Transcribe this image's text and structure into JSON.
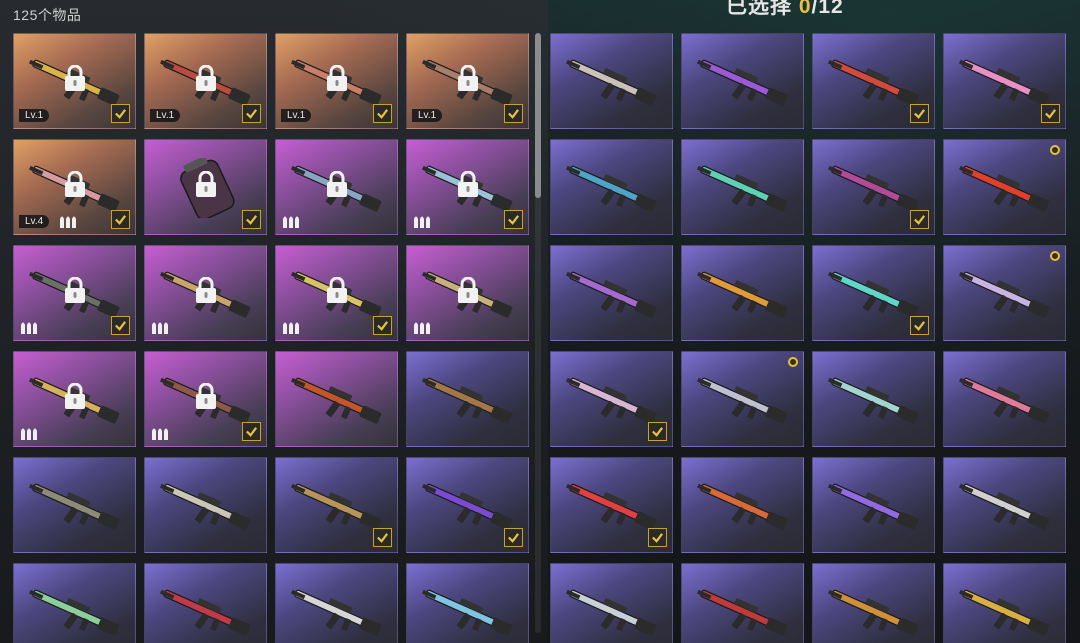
{
  "header": {
    "count_label": "125个物品",
    "selected_prefix": "已选择 ",
    "selected_count": "0",
    "selected_total": "/12"
  },
  "colors": {
    "accent": "#e9c23a",
    "check_border": "#c9a227"
  },
  "left_items": [
    {
      "bg": "gold",
      "weapon_color": "#d9b34a",
      "locked": true,
      "level": "Lv.1",
      "checked": true,
      "ammo": false
    },
    {
      "bg": "gold",
      "weapon_color": "#b94b3f",
      "locked": true,
      "level": "Lv.1",
      "checked": true,
      "ammo": false
    },
    {
      "bg": "gold",
      "weapon_color": "#c97f66",
      "locked": true,
      "level": "Lv.1",
      "checked": true,
      "ammo": false
    },
    {
      "bg": "gold",
      "weapon_color": "#a77e6a",
      "locked": true,
      "level": "Lv.1",
      "checked": true,
      "ammo": false
    },
    {
      "bg": "gold",
      "weapon_color": "#d79aa1",
      "locked": true,
      "level": "Lv.4",
      "checked": true,
      "ammo": true
    },
    {
      "bg": "magenta",
      "weapon_color": "#4a3547",
      "locked": true,
      "level": "",
      "checked": true,
      "ammo": false,
      "shape": "grenade"
    },
    {
      "bg": "magenta",
      "weapon_color": "#8aa4c6",
      "locked": true,
      "level": "",
      "checked": false,
      "ammo": true
    },
    {
      "bg": "magenta",
      "weapon_color": "#9bc1d8",
      "locked": true,
      "level": "",
      "checked": true,
      "ammo": true
    },
    {
      "bg": "magenta",
      "weapon_color": "#6b6f66",
      "locked": true,
      "level": "",
      "checked": true,
      "ammo": true
    },
    {
      "bg": "magenta",
      "weapon_color": "#c8a66b",
      "locked": true,
      "level": "",
      "checked": false,
      "ammo": true
    },
    {
      "bg": "magenta",
      "weapon_color": "#d9c264",
      "locked": true,
      "level": "",
      "checked": true,
      "ammo": true
    },
    {
      "bg": "magenta",
      "weapon_color": "#c9b07a",
      "locked": true,
      "level": "",
      "checked": false,
      "ammo": true
    },
    {
      "bg": "magenta",
      "weapon_color": "#d6b15c",
      "locked": true,
      "level": "",
      "checked": false,
      "ammo": true
    },
    {
      "bg": "magenta",
      "weapon_color": "#8c5a4a",
      "locked": true,
      "level": "",
      "checked": true,
      "ammo": true
    },
    {
      "bg": "magenta",
      "weapon_color": "#c2552b",
      "locked": false,
      "level": "",
      "checked": false,
      "ammo": false
    },
    {
      "bg": "purple",
      "weapon_color": "#a3774a",
      "locked": false,
      "level": "",
      "checked": false,
      "ammo": false
    },
    {
      "bg": "purple",
      "weapon_color": "#8e8a78",
      "locked": false,
      "level": "",
      "checked": false,
      "ammo": false
    },
    {
      "bg": "purple",
      "weapon_color": "#c9c6b6",
      "locked": false,
      "level": "",
      "checked": false,
      "ammo": false
    },
    {
      "bg": "purple",
      "weapon_color": "#b8935a",
      "locked": false,
      "level": "",
      "checked": true,
      "ammo": false
    },
    {
      "bg": "purple",
      "weapon_color": "#7a4ad1",
      "locked": false,
      "level": "",
      "checked": true,
      "ammo": false
    },
    {
      "bg": "purple",
      "weapon_color": "#8dcf9a",
      "locked": false,
      "level": "",
      "checked": false,
      "ammo": false
    },
    {
      "bg": "purple",
      "weapon_color": "#c23a4a",
      "locked": false,
      "level": "",
      "checked": false,
      "ammo": false
    },
    {
      "bg": "purple",
      "weapon_color": "#d6d6d6",
      "locked": false,
      "level": "",
      "checked": false,
      "ammo": false
    },
    {
      "bg": "purple",
      "weapon_color": "#7fc4e0",
      "locked": false,
      "level": "",
      "checked": false,
      "ammo": false
    }
  ],
  "right_items": [
    {
      "bg": "purple",
      "weapon_color": "#c9c2b8",
      "checked": false,
      "dot": false
    },
    {
      "bg": "purple",
      "weapon_color": "#9a5ad8",
      "checked": false,
      "dot": false
    },
    {
      "bg": "purple",
      "weapon_color": "#d04a3e",
      "checked": true,
      "dot": false
    },
    {
      "bg": "purple",
      "weapon_color": "#e88fc6",
      "checked": true,
      "dot": false
    },
    {
      "bg": "purple",
      "weapon_color": "#4fa3c9",
      "checked": false,
      "dot": false
    },
    {
      "bg": "purple",
      "weapon_color": "#5fd0b4",
      "checked": false,
      "dot": false
    },
    {
      "bg": "purple",
      "weapon_color": "#b24a9a",
      "checked": true,
      "dot": false
    },
    {
      "bg": "purple",
      "weapon_color": "#e0402a",
      "checked": false,
      "dot": true
    },
    {
      "bg": "purple",
      "weapon_color": "#a46ad0",
      "checked": false,
      "dot": false
    },
    {
      "bg": "purple",
      "weapon_color": "#e19a3a",
      "checked": false,
      "dot": false
    },
    {
      "bg": "purple",
      "weapon_color": "#5fd6c8",
      "checked": true,
      "dot": false
    },
    {
      "bg": "purple",
      "weapon_color": "#c8b4e0",
      "checked": false,
      "dot": true
    },
    {
      "bg": "purple",
      "weapon_color": "#d6b6d0",
      "checked": true,
      "dot": false
    },
    {
      "bg": "purple",
      "weapon_color": "#bfc0d0",
      "checked": false,
      "dot": true
    },
    {
      "bg": "purple",
      "weapon_color": "#a4d4d0",
      "checked": false,
      "dot": false
    },
    {
      "bg": "purple",
      "weapon_color": "#e07a9a",
      "checked": false,
      "dot": false
    },
    {
      "bg": "purple",
      "weapon_color": "#e04040",
      "checked": true,
      "dot": false
    },
    {
      "bg": "purple",
      "weapon_color": "#d86a3a",
      "checked": false,
      "dot": false
    },
    {
      "bg": "purple",
      "weapon_color": "#8f6ae0",
      "checked": false,
      "dot": false
    },
    {
      "bg": "purple",
      "weapon_color": "#d0d0d0",
      "checked": false,
      "dot": false
    },
    {
      "bg": "purple",
      "weapon_color": "#c9d0d8",
      "checked": false,
      "dot": false
    },
    {
      "bg": "purple",
      "weapon_color": "#c03a3a",
      "checked": false,
      "dot": false
    },
    {
      "bg": "purple",
      "weapon_color": "#d0903a",
      "checked": false,
      "dot": false
    },
    {
      "bg": "purple",
      "weapon_color": "#d9b040",
      "checked": false,
      "dot": false
    }
  ]
}
